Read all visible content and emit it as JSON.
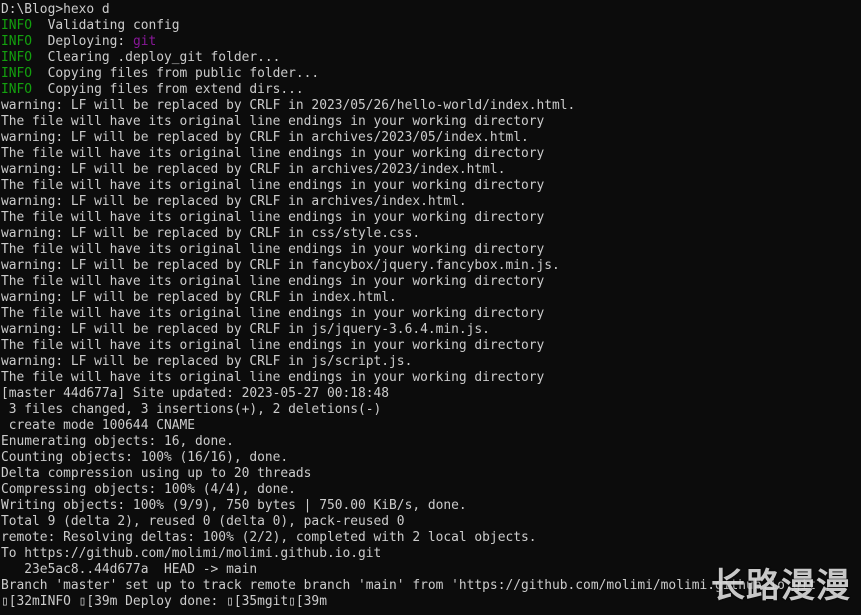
{
  "terminal": {
    "lines": [
      [
        {
          "text": "D:\\Blog>hexo d"
        }
      ],
      [
        {
          "text": "INFO",
          "color": "info"
        },
        {
          "text": "  Validating config"
        }
      ],
      [
        {
          "text": "INFO",
          "color": "info"
        },
        {
          "text": "  Deploying: "
        },
        {
          "text": "git",
          "color": "git"
        }
      ],
      [
        {
          "text": "INFO",
          "color": "info"
        },
        {
          "text": "  Clearing .deploy_git folder..."
        }
      ],
      [
        {
          "text": "INFO",
          "color": "info"
        },
        {
          "text": "  Copying files from public folder..."
        }
      ],
      [
        {
          "text": "INFO",
          "color": "info"
        },
        {
          "text": "  Copying files from extend dirs..."
        }
      ],
      [
        {
          "text": "warning: LF will be replaced by CRLF in 2023/05/26/hello-world/index.html."
        }
      ],
      [
        {
          "text": "The file will have its original line endings in your working directory"
        }
      ],
      [
        {
          "text": "warning: LF will be replaced by CRLF in archives/2023/05/index.html."
        }
      ],
      [
        {
          "text": "The file will have its original line endings in your working directory"
        }
      ],
      [
        {
          "text": "warning: LF will be replaced by CRLF in archives/2023/index.html."
        }
      ],
      [
        {
          "text": "The file will have its original line endings in your working directory"
        }
      ],
      [
        {
          "text": "warning: LF will be replaced by CRLF in archives/index.html."
        }
      ],
      [
        {
          "text": "The file will have its original line endings in your working directory"
        }
      ],
      [
        {
          "text": "warning: LF will be replaced by CRLF in css/style.css."
        }
      ],
      [
        {
          "text": "The file will have its original line endings in your working directory"
        }
      ],
      [
        {
          "text": "warning: LF will be replaced by CRLF in fancybox/jquery.fancybox.min.js."
        }
      ],
      [
        {
          "text": "The file will have its original line endings in your working directory"
        }
      ],
      [
        {
          "text": "warning: LF will be replaced by CRLF in index.html."
        }
      ],
      [
        {
          "text": "The file will have its original line endings in your working directory"
        }
      ],
      [
        {
          "text": "warning: LF will be replaced by CRLF in js/jquery-3.6.4.min.js."
        }
      ],
      [
        {
          "text": "The file will have its original line endings in your working directory"
        }
      ],
      [
        {
          "text": "warning: LF will be replaced by CRLF in js/script.js."
        }
      ],
      [
        {
          "text": "The file will have its original line endings in your working directory"
        }
      ],
      [
        {
          "text": "[master 44d677a] Site updated: 2023-05-27 00:18:48"
        }
      ],
      [
        {
          "text": " 3 files changed, 3 insertions(+), 2 deletions(-)"
        }
      ],
      [
        {
          "text": " create mode 100644 CNAME"
        }
      ],
      [
        {
          "text": "Enumerating objects: 16, done."
        }
      ],
      [
        {
          "text": "Counting objects: 100% (16/16), done."
        }
      ],
      [
        {
          "text": "Delta compression using up to 20 threads"
        }
      ],
      [
        {
          "text": "Compressing objects: 100% (4/4), done."
        }
      ],
      [
        {
          "text": "Writing objects: 100% (9/9), 750 bytes | 750.00 KiB/s, done."
        }
      ],
      [
        {
          "text": "Total 9 (delta 2), reused 0 (delta 0), pack-reused 0"
        }
      ],
      [
        {
          "text": "remote: Resolving deltas: 100% (2/2), completed with 2 local objects."
        }
      ],
      [
        {
          "text": "To https://github.com/molimi/molimi.github.io.git"
        }
      ],
      [
        {
          "text": "   23e5ac8..44d677a  HEAD -> main"
        }
      ],
      [
        {
          "text": "Branch 'master' set up to track remote branch 'main' from 'https://github.com/molimi/molimi.github.io.git'."
        }
      ],
      [
        {
          "text": "▯[32mINFO ▯[39m Deploy done: ▯[35mgit▯[39m"
        }
      ]
    ]
  },
  "watermark": {
    "text": "长路漫漫"
  }
}
